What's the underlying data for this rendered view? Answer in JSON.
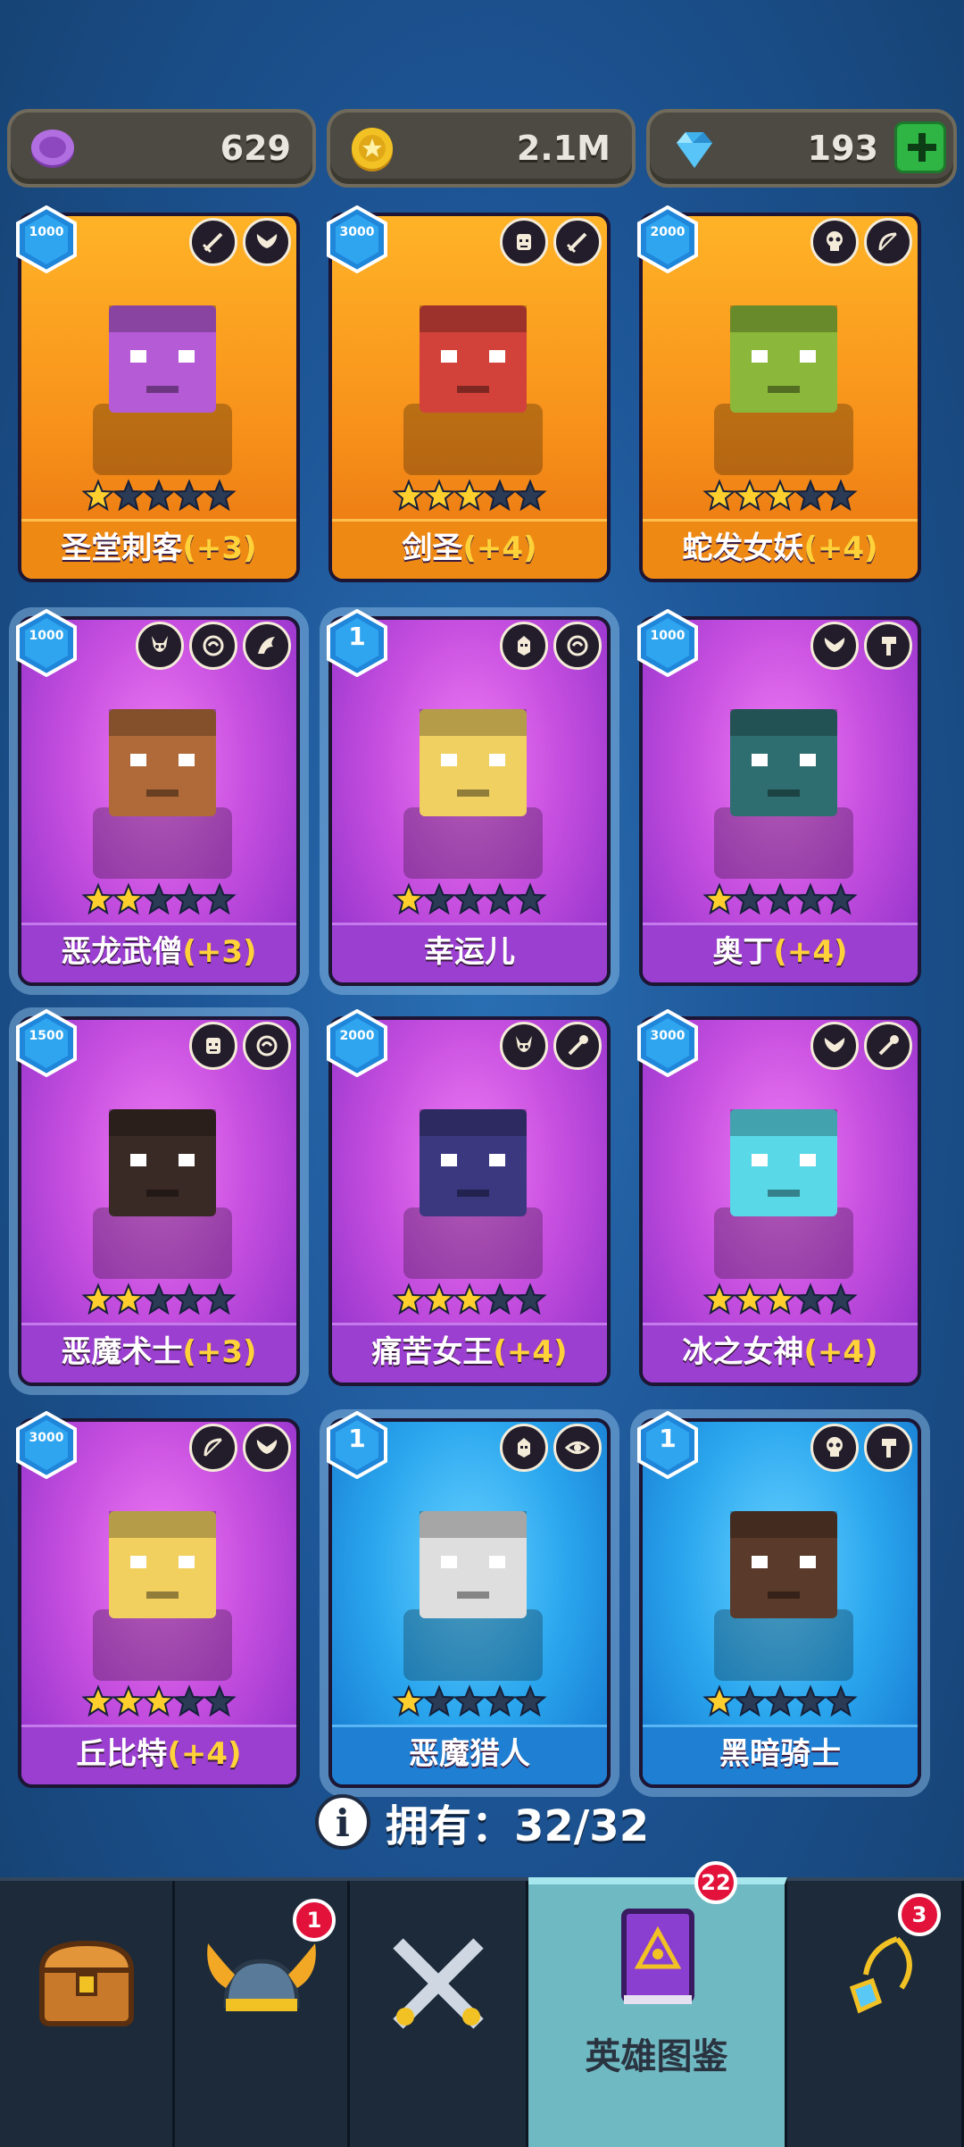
{
  "currency": {
    "purple_coin": {
      "value": "629",
      "icon": "purple-coin-icon",
      "color": "#a45bd6"
    },
    "gold_coin": {
      "value": "2.1M",
      "icon": "gold-coin-icon",
      "color": "#f2c225"
    },
    "gems": {
      "value": "193",
      "icon": "diamond-icon",
      "color": "#5ac8f5"
    }
  },
  "heroes": [
    {
      "name": "圣堂刺客",
      "bonus": "(+3)",
      "level": "1000",
      "stars": 1,
      "rarity": "orange",
      "icons": [
        "sword-icon",
        "wings-icon"
      ]
    },
    {
      "name": "剑圣",
      "bonus": "(+4)",
      "level": "3000",
      "stars": 3,
      "rarity": "orange",
      "icons": [
        "orc-icon",
        "sword-icon"
      ]
    },
    {
      "name": "蛇发女妖",
      "bonus": "(+4)",
      "level": "2000",
      "stars": 3,
      "rarity": "orange",
      "icons": [
        "skull-icon",
        "bow-icon"
      ]
    },
    {
      "name": "恶龙武僧",
      "bonus": "(+3)",
      "level": "1000",
      "stars": 2,
      "rarity": "purple",
      "icons": [
        "demon-icon",
        "fist-icon",
        "dragon-icon"
      ],
      "selected": true
    },
    {
      "name": "幸运儿",
      "bonus": "",
      "level": "1",
      "stars": 1,
      "rarity": "purple",
      "icons": [
        "elf-icon",
        "fist-icon"
      ],
      "selected": true
    },
    {
      "name": "奥丁",
      "bonus": "(+4)",
      "level": "1000",
      "stars": 1,
      "rarity": "purple",
      "icons": [
        "wings-icon",
        "hammer-icon"
      ]
    },
    {
      "name": "恶魔术士",
      "bonus": "(+3)",
      "level": "1500",
      "stars": 2,
      "rarity": "purple",
      "icons": [
        "orc-icon",
        "fist-icon"
      ],
      "selected": true
    },
    {
      "name": "痛苦女王",
      "bonus": "(+4)",
      "level": "2000",
      "stars": 3,
      "rarity": "purple",
      "icons": [
        "demon-icon",
        "staff-icon"
      ]
    },
    {
      "name": "冰之女神",
      "bonus": "(+4)",
      "level": "3000",
      "stars": 3,
      "rarity": "purple",
      "icons": [
        "wings-icon",
        "staff-icon"
      ]
    },
    {
      "name": "丘比特",
      "bonus": "(+4)",
      "level": "3000",
      "stars": 3,
      "rarity": "purple",
      "icons": [
        "bow-icon",
        "wings-icon"
      ]
    },
    {
      "name": "恶魔猎人",
      "bonus": "",
      "level": "1",
      "stars": 1,
      "rarity": "blue",
      "icons": [
        "elf-icon",
        "eye-icon"
      ],
      "selected": true
    },
    {
      "name": "黑暗骑士",
      "bonus": "",
      "level": "1",
      "stars": 1,
      "rarity": "blue",
      "icons": [
        "skull-icon",
        "hammer-icon"
      ],
      "selected": true
    }
  ],
  "owned": {
    "label": "拥有：32/32"
  },
  "nav": {
    "tabs": [
      {
        "icon": "treasure-chest-icon",
        "label": "",
        "badge": ""
      },
      {
        "icon": "viking-helmet-icon",
        "label": "",
        "badge": "1"
      },
      {
        "icon": "crossed-swords-icon",
        "label": "",
        "badge": ""
      },
      {
        "icon": "hero-book-icon",
        "label": "英雄图鉴",
        "badge": "22",
        "active": true
      },
      {
        "icon": "amulet-icon",
        "label": "",
        "badge": "3"
      }
    ]
  },
  "colors": {
    "star_on": "#ffcf2e",
    "star_off": "#2b3a55",
    "accent": "#6fb9c2"
  }
}
